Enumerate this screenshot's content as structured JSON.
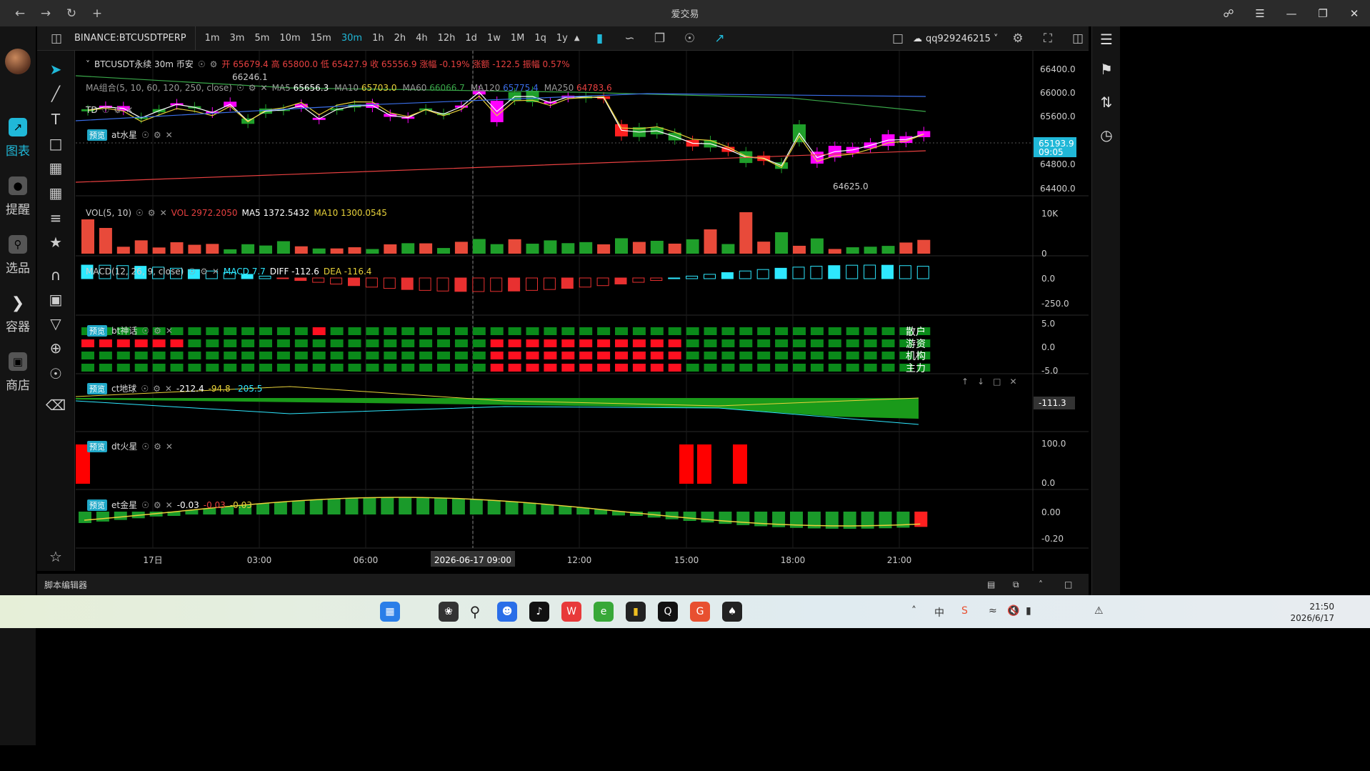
{
  "app": {
    "title": "爱交易"
  },
  "nav": [
    {
      "label": "图表",
      "icon": "chart-icon"
    },
    {
      "label": "提醒",
      "icon": "bell-icon"
    },
    {
      "label": "选品",
      "icon": "search-chart-icon"
    },
    {
      "label": "容器",
      "icon": "container-icon"
    },
    {
      "label": "商店",
      "icon": "store-icon"
    }
  ],
  "toolbar": {
    "symbol": "BINANCE:BTCUSDTPERP",
    "intervals": [
      "1m",
      "3m",
      "5m",
      "10m",
      "15m",
      "30m",
      "1h",
      "2h",
      "4h",
      "12h",
      "1d",
      "1w",
      "1M",
      "1q",
      "1y"
    ],
    "active_interval": "30m",
    "account": "qq929246215"
  },
  "main_pane": {
    "title": "BTCUSDT永续 30m 币安",
    "ohlc": "开 65679.4 高 65800.0 低 65427.9 收 65556.9 涨幅 -0.19% 涨额 -122.5 振幅 0.57%",
    "ma_label": "MA组合(5, 10, 60, 120, 250, close)",
    "ma_values": [
      {
        "name": "MA5",
        "value": "65656.3",
        "color": "#ffffff"
      },
      {
        "name": "MA10",
        "value": "65703.0",
        "color": "#e8d23a"
      },
      {
        "name": "MA60",
        "value": "66066.7",
        "color": "#3aa84a"
      },
      {
        "name": "MA120",
        "value": "65775.4",
        "color": "#3a6ee8"
      },
      {
        "name": "MA250",
        "value": "64783.6",
        "color": "#e84040"
      }
    ],
    "td_label": "TD",
    "at_label": "at水星",
    "high_mark": "66246.1",
    "low_mark": "64625.0",
    "price_axis": [
      "66400.0",
      "66000.0",
      "65600.0",
      "64800.0",
      "64400.0"
    ],
    "last_price": "65193.9",
    "last_time": "09:05"
  },
  "vol_pane": {
    "label": "VOL(5, 10)",
    "vol": "VOL 2972.2050",
    "ma5": "MA5 1372.5432",
    "ma10": "MA10 1300.0545",
    "axis": [
      "10K",
      "0"
    ]
  },
  "macd_pane": {
    "label": "MACD(12, 26, 9, close)",
    "macd": "MACD 7.7",
    "diff": "DIFF -112.6",
    "dea": "DEA -116.4",
    "axis": [
      "0.0",
      "-250.0"
    ]
  },
  "bt_pane": {
    "label": "bt神话",
    "rows": [
      "散户",
      "游资",
      "机构",
      "主力"
    ],
    "axis": [
      "5.0",
      "0.0",
      "-5.0"
    ]
  },
  "ct_pane": {
    "label": "ct地球",
    "v1": "-212.4",
    "v2": "-94.8",
    "v3": "-205.5",
    "axis_tag": "-111.3"
  },
  "dt_pane": {
    "label": "dt火星",
    "axis": [
      "100.0",
      "0.0"
    ]
  },
  "et_pane": {
    "label": "et金星",
    "v1": "-0.03",
    "v2": "-0.03",
    "v3": "-0.03",
    "axis": [
      "0.00",
      "-0.20"
    ]
  },
  "preview_tag": "预览",
  "time_axis": [
    "17日",
    "03:00",
    "06:00",
    "09:00",
    "12:00",
    "15:00",
    "18:00",
    "21:00"
  ],
  "crosshair_time": "2026-06-17   09:00",
  "bottom": {
    "label": "脚本编辑器"
  },
  "clock": {
    "time": "21:50",
    "date": "2026/6/17"
  },
  "tray": {
    "ime": "中"
  }
}
